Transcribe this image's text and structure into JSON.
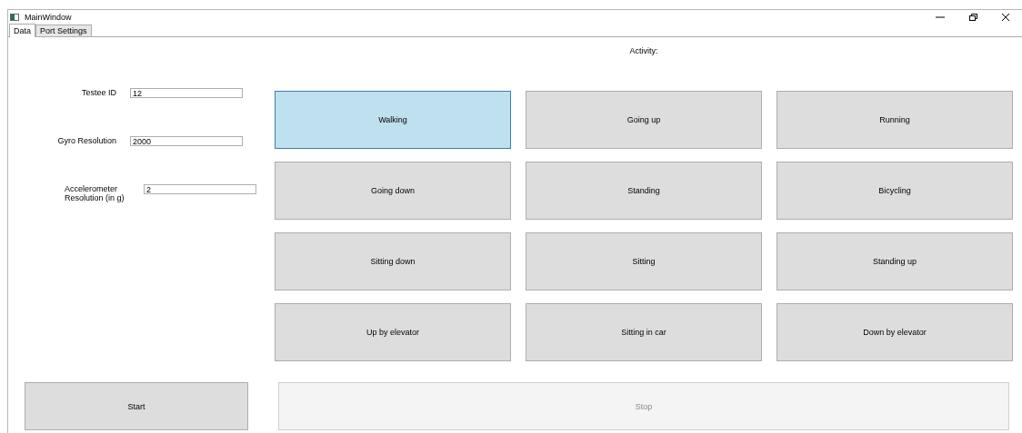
{
  "window": {
    "title": "MainWindow"
  },
  "tabs": [
    {
      "label": "Data",
      "selected": true
    },
    {
      "label": "Port Settings",
      "selected": false
    }
  ],
  "fields": [
    {
      "label": "Testee ID",
      "value": "12"
    },
    {
      "label": "Gyro Resolution",
      "value": "2000"
    },
    {
      "label": "Accelerometer Resolution (in g)",
      "value": "2"
    }
  ],
  "activity_label": "Activity:",
  "activities": [
    {
      "label": "Walking",
      "selected": true
    },
    {
      "label": "Going up",
      "selected": false
    },
    {
      "label": "Running",
      "selected": false
    },
    {
      "label": "Going down",
      "selected": false
    },
    {
      "label": "Standing",
      "selected": false
    },
    {
      "label": "Bicycling",
      "selected": false
    },
    {
      "label": "Sitting down",
      "selected": false
    },
    {
      "label": "Sitting",
      "selected": false
    },
    {
      "label": "Standing up",
      "selected": false
    },
    {
      "label": "Up by elevator",
      "selected": false
    },
    {
      "label": "Sitting in car",
      "selected": false
    },
    {
      "label": "Down by elevator",
      "selected": false
    }
  ],
  "buttons": [
    {
      "label": "Start",
      "disabled": false
    },
    {
      "label": "Stop",
      "disabled": true
    }
  ]
}
